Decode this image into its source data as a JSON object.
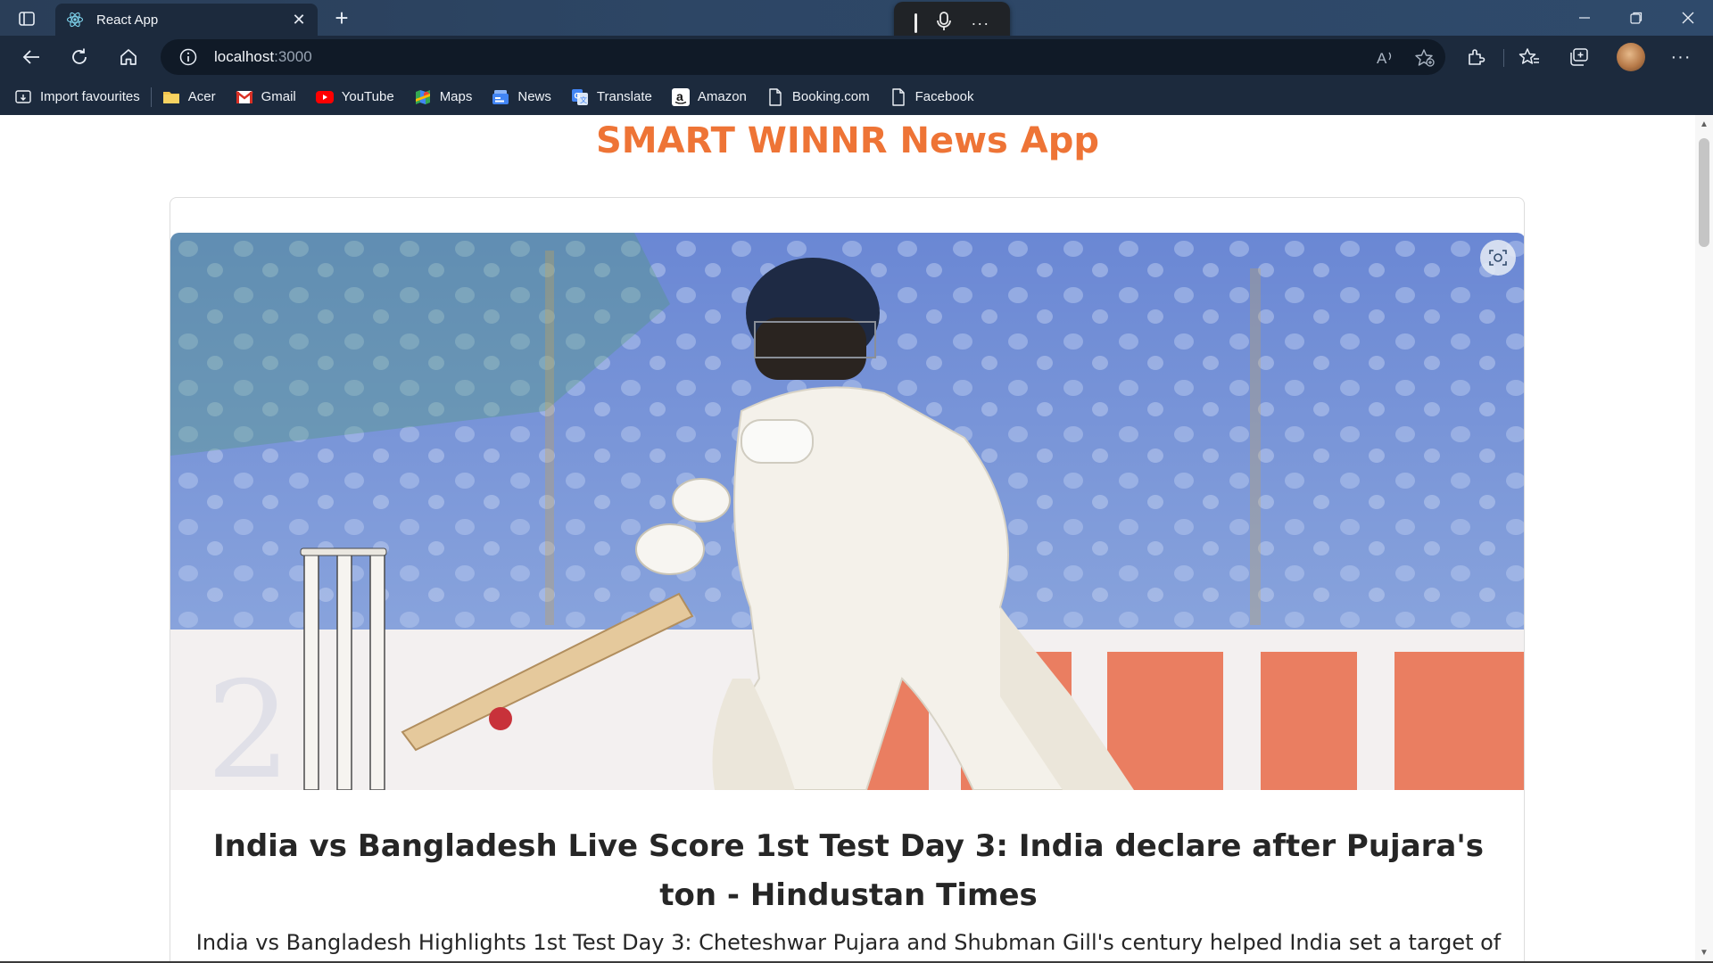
{
  "browser": {
    "tab": {
      "title": "React App"
    },
    "address": {
      "host": "localhost",
      "port": ":3000"
    },
    "bookmarks": [
      {
        "label": "Import favourites",
        "icon": "import-icon"
      },
      {
        "label": "Acer",
        "icon": "folder-icon"
      },
      {
        "label": "Gmail",
        "icon": "gmail-icon"
      },
      {
        "label": "YouTube",
        "icon": "youtube-icon"
      },
      {
        "label": "Maps",
        "icon": "maps-icon"
      },
      {
        "label": "News",
        "icon": "news-icon"
      },
      {
        "label": "Translate",
        "icon": "translate-icon"
      },
      {
        "label": "Amazon",
        "icon": "amazon-icon"
      },
      {
        "label": "Booking.com",
        "icon": "page-icon"
      },
      {
        "label": "Facebook",
        "icon": "page-icon"
      }
    ]
  },
  "app": {
    "title": "SMART WINNR News App",
    "article": {
      "headline": "India vs Bangladesh Live Score 1st Test Day 3: India declare after Pujara's ton - Hindustan Times",
      "description": "India vs Bangladesh Highlights 1st Test Day 3: Cheteshwar Pujara and Shubman Gill's century helped India set a target of"
    }
  },
  "colors": {
    "title": "#ee7436",
    "chrome": "#1c2a3d",
    "text": "#262626"
  }
}
